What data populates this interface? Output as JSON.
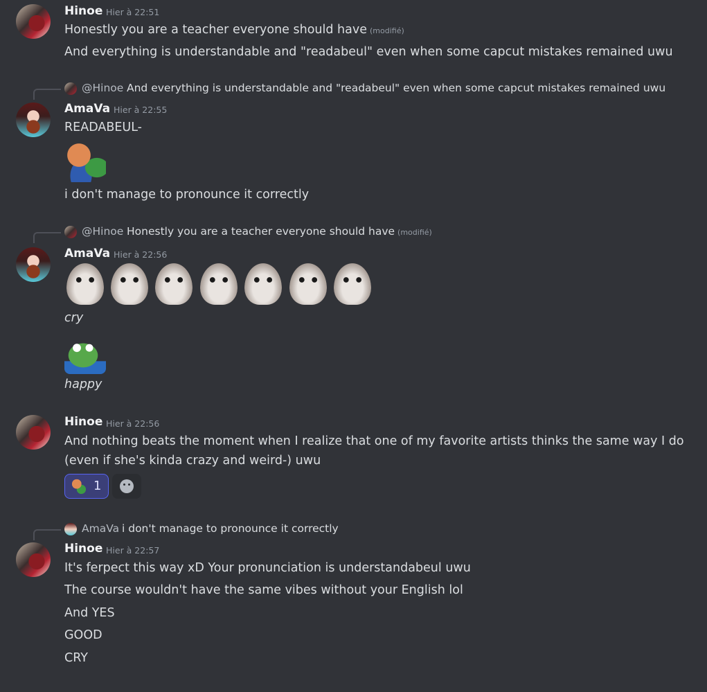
{
  "messages": {
    "m1": {
      "author": "Hinoe",
      "timestamp": "Hier à 22:51",
      "lines": [
        "Honestly you are a teacher everyone should have",
        "And everything is understandable and \"readabeul\" even when some capcut mistakes remained uwu"
      ],
      "edited": "(modifié)"
    },
    "m2": {
      "reply": {
        "author": "@Hinoe",
        "text": "And everything is understandable and \"readabeul\" even when some capcut mistakes remained uwu"
      },
      "author": "AmaVa",
      "timestamp": "Hier à 22:55",
      "lines": [
        "READABEUL-",
        "i don't manage to pronounce it correctly"
      ]
    },
    "m3": {
      "reply": {
        "author": "@Hinoe",
        "text": "Honestly you are a teacher everyone should have",
        "edited": "(modifié)"
      },
      "author": "AmaVa",
      "timestamp": "Hier à 22:56",
      "lines": [
        "cry",
        "happy"
      ]
    },
    "m4": {
      "author": "Hinoe",
      "timestamp": "Hier à 22:56",
      "text": "And nothing beats the moment when I realize that one of my favorite artists thinks the same way I do (even if she's kinda crazy and weird-) uwu",
      "reaction_count": "1"
    },
    "m5": {
      "reply": {
        "author": "AmaVa",
        "text": "i don't manage to pronounce it correctly"
      },
      "author": "Hinoe",
      "timestamp": "Hier à 22:57",
      "lines": [
        "It's ferpect this way xD Your pronunciation is understandabeul uwu",
        "The course wouldn't have the same vibes without your English lol",
        "And YES",
        "GOOD",
        "CRY"
      ]
    }
  },
  "colors": {
    "background": "#313338",
    "text": "#dbdee1",
    "author": "#f2f3f5",
    "muted": "#949ba4",
    "reaction_bg": "#3b3f78",
    "reaction_border": "#5865f2"
  }
}
